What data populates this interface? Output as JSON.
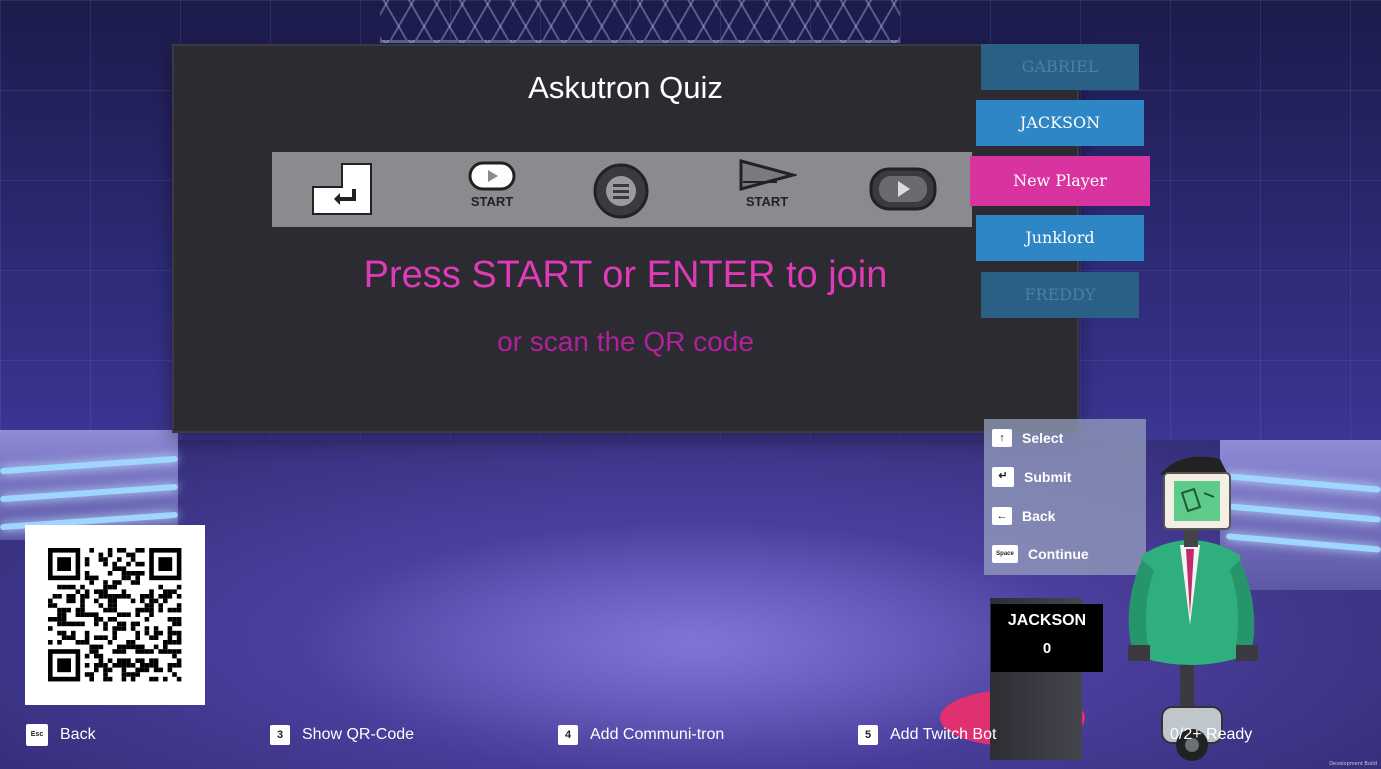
{
  "game": {
    "title": "Askutron Quiz",
    "join_prompt": "Press START or ENTER to join",
    "qr_prompt": "or scan the QR code",
    "controls_strip": {
      "items": [
        {
          "icon": "enter-key-icon",
          "label": ""
        },
        {
          "icon": "gamepad-start-button-icon",
          "label": "START"
        },
        {
          "icon": "menu-button-icon",
          "label": ""
        },
        {
          "icon": "triangle-start-button-icon",
          "label": "START"
        },
        {
          "icon": "play-button-icon",
          "label": ""
        }
      ]
    }
  },
  "players": [
    {
      "name": "GABRIEL",
      "state": "dimmed"
    },
    {
      "name": "JACKSON",
      "state": "normal"
    },
    {
      "name": "New Player",
      "state": "selected"
    },
    {
      "name": "Junklord",
      "state": "normal"
    },
    {
      "name": "FREDDY",
      "state": "dimmed"
    }
  ],
  "hints": [
    {
      "key": "↑",
      "icon": "arrow-up-key-icon",
      "label": "Select"
    },
    {
      "key": "↵",
      "icon": "enter-key-icon",
      "label": "Submit"
    },
    {
      "key": "←",
      "icon": "backspace-key-icon",
      "label": "Back"
    },
    {
      "key": "Space",
      "icon": "space-key-icon",
      "label": "Continue"
    }
  ],
  "podium": {
    "player_name": "JACKSON",
    "score": "0"
  },
  "bottom_bar": {
    "back": {
      "key": "Esc",
      "label": "Back"
    },
    "qr": {
      "key": "3",
      "label": "Show QR-Code"
    },
    "communitron": {
      "key": "4",
      "label": "Add Communi-tron"
    },
    "twitch": {
      "key": "5",
      "label": "Add Twitch Bot"
    },
    "ready_status": "0/2+ Ready"
  },
  "footer": {
    "build": "Development Build"
  },
  "colors": {
    "accent_pink": "#e03ab8",
    "player_blue": "#2f86c4",
    "player_selected": "#d9339f",
    "board_bg": "#2b2b31"
  }
}
